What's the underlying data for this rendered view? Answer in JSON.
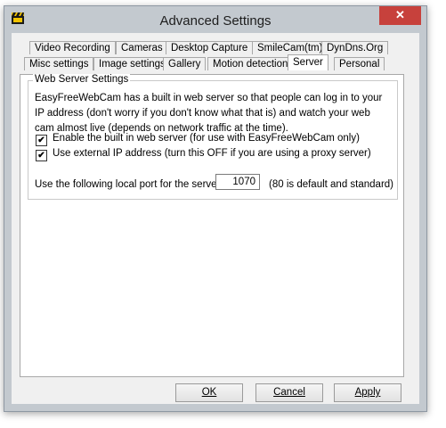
{
  "window": {
    "title": "Advanced Settings",
    "close_glyph": "✕",
    "app_icon": "clapperboard-icon"
  },
  "tabs": {
    "row1": [
      "Video Recording",
      "Cameras",
      "Desktop Capture",
      "SmileCam(tm)",
      "DynDns.Org"
    ],
    "row2": [
      "Misc settings",
      "Image settings",
      "Gallery",
      "Motion detection",
      "Server",
      "Personal"
    ],
    "active": "Server"
  },
  "server": {
    "group_title": "Web Server Settings",
    "description": "EasyFreeWebCam has a built in web server so that people can log in to your IP address (don't worry if you don't know what that is) and watch your web cam almost live (depends on network traffic at the time).",
    "enable_server": {
      "label": "Enable the built in web server (for use with EasyFreeWebCam only)",
      "checked": true
    },
    "external_ip": {
      "label": "Use external IP address (turn this OFF if you are using a proxy server)",
      "checked": true
    },
    "port_label": "Use the following local port for the server",
    "port_value": "1070",
    "port_hint": "(80 is default and standard)"
  },
  "buttons": {
    "ok": "OK",
    "cancel": "Cancel",
    "apply": "Apply"
  }
}
